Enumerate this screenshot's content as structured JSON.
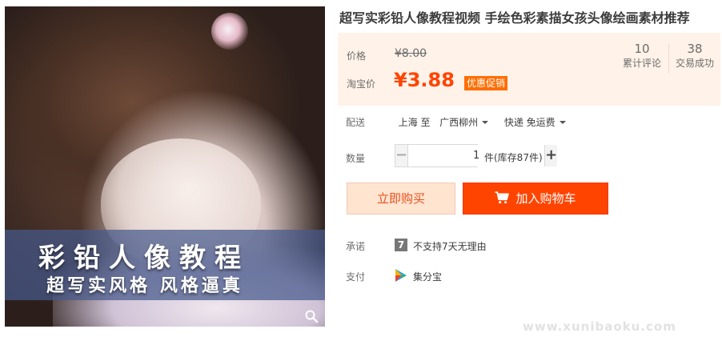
{
  "product": {
    "title": "超写实彩铅人像教程视频 手绘色彩素描女孩头像绘画素材推荐",
    "image": {
      "banner_title": "彩铅人像教程",
      "banner_subtitle": "超写实风格 风格逼真",
      "zoom_icon": "magnifier-icon"
    }
  },
  "price_panel": {
    "price_label": "价格",
    "original_price": "¥8.00",
    "taobao_price_label": "淘宝价",
    "promo_price": "¥3.88",
    "promo_badge": "优惠促销",
    "stats": [
      {
        "value": "10",
        "label": "累计评论"
      },
      {
        "value": "38",
        "label": "交易成功"
      }
    ]
  },
  "shipping": {
    "label": "配送",
    "from": "上海 至",
    "to": "广西柳州",
    "method": "快递 免运费"
  },
  "quantity": {
    "label": "数量",
    "minus": "−",
    "value": "1",
    "plus": "+",
    "stock_text": "件(库存87件)"
  },
  "actions": {
    "buy_now": "立即购买",
    "add_to_cart": "加入购物车",
    "add_to_cart_color": "#ff4400",
    "buy_now_bg": "#ffe4d0"
  },
  "promise": {
    "label": "承诺",
    "badge": "7",
    "text": "不支持7天无理由"
  },
  "payment": {
    "label": "支付",
    "method": "集分宝"
  },
  "watermark": "www.xunibaoku.com"
}
